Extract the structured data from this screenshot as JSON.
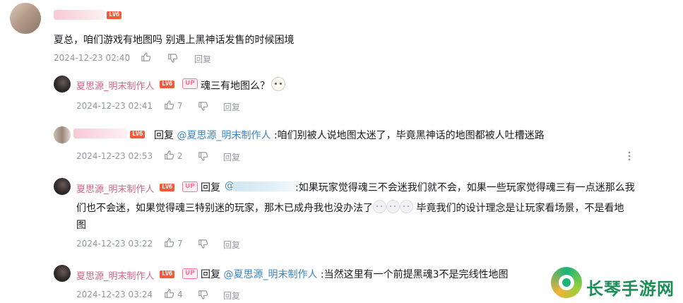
{
  "comment": {
    "level_badge": "LV6",
    "text": "夏总，咱们游戏有地图吗 别遇上黑神话发售的时候困境",
    "time": "2024-12-23 02:40",
    "reply_label": "回复"
  },
  "replies": [
    {
      "username": "夏思源_明末制作人",
      "level_badge": "LV6",
      "up_badge": "UP",
      "text": "魂三有地图么？",
      "time": "2024-12-23 02:41",
      "likes": "7",
      "reply_label": "回复"
    },
    {
      "level_badge": "LV6",
      "reply_prefix": "回复",
      "mention": "@夏思源_明末制作人",
      "text": ":咱们别被人说地图太迷了，毕竟黑神话的地图都被人吐槽迷路",
      "time": "2024-12-23 02:53",
      "likes": "2",
      "reply_label": "回复",
      "more_icon": "more-vertical-icon"
    },
    {
      "username": "夏思源_明末制作人",
      "level_badge": "LV6",
      "up_badge": "UP",
      "reply_prefix": "回复",
      "mention_prefix": "@",
      "text_line1": ":如果玩家觉得魂三不会迷我们就不会，如果一些玩家觉得魂三有一点迷那么我",
      "text_line2a": "们也不会迷，如果觉得魂三特别迷的玩家，那木已成舟我也没办法了",
      "text_line2b": " 毕竟我们的设计理念是让玩家看场景，不是看地",
      "text_line3": "图",
      "time": "2024-12-23 03:22",
      "likes": "7",
      "reply_label": "回复"
    },
    {
      "username": "夏思源_明末制作人",
      "level_badge": "LV6",
      "up_badge": "UP",
      "reply_prefix": "回复",
      "mention": "@夏思源_明末制作人",
      "text": ":当然这里有一个前提黑魂3不是完线性地图",
      "time": "2024-12-23 03:24",
      "likes": "4",
      "reply_label": "回复"
    }
  ],
  "watermark": {
    "brand": "长琴手游网"
  },
  "colors": {
    "username": "#d16785",
    "mention": "#3a86c9",
    "meta": "#9499a0",
    "level_red": "#f35a3a",
    "up_pink": "#fb7299"
  }
}
